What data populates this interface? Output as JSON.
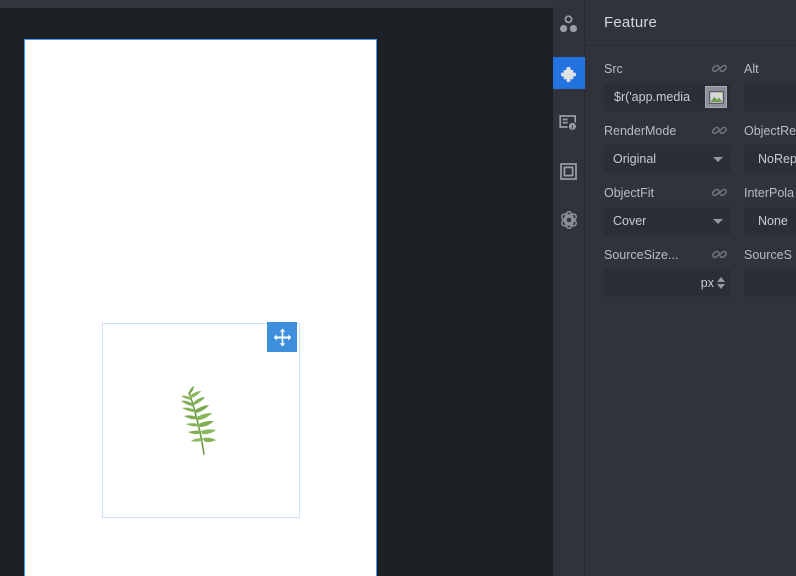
{
  "window": {
    "background_color": "#1c1f24",
    "panel_color": "#30333c",
    "accent_color": "#2272e0",
    "selection_border_color": "#3d9bf0"
  },
  "canvas": {
    "name": "device-preview-canvas",
    "background": "#ffffff",
    "selected_element": {
      "name": "image-component",
      "border_color": "#cfe2f7",
      "content": "fern-leaf-image"
    },
    "move_handle": {
      "icon": "move-arrows-icon",
      "color": "#3d8fdd"
    }
  },
  "icon_rail": {
    "items": [
      {
        "name": "structure-icon",
        "label": "Structure",
        "active": false
      },
      {
        "name": "puzzle-icon",
        "label": "Attributes",
        "active": true
      },
      {
        "name": "card-info-icon",
        "label": "Component Info",
        "active": false
      },
      {
        "name": "frame-square-icon",
        "label": "Layout",
        "active": false
      },
      {
        "name": "atom-icon",
        "label": "Effects",
        "active": false
      }
    ]
  },
  "inspector": {
    "title": "Feature",
    "rows": [
      {
        "left": {
          "label": "Src",
          "link_icon": "chain-link-icon",
          "type": "text-with-picker",
          "value": "$r('app.media",
          "placeholder": "",
          "picker_icon": "image-picker-icon"
        },
        "right": {
          "label": "Alt",
          "link_icon": "chain-link-icon",
          "type": "text",
          "value": "",
          "placeholder": ""
        }
      },
      {
        "left": {
          "label": "RenderMode",
          "link_icon": "chain-link-icon",
          "type": "select",
          "value": "Original",
          "caret_icon": "chevron-down-icon"
        },
        "right": {
          "label": "ObjectRe",
          "link_icon": "chain-link-icon",
          "type": "select",
          "value": "NoRepe",
          "caret_icon": "chevron-down-icon"
        }
      },
      {
        "left": {
          "label": "ObjectFit",
          "link_icon": "chain-link-icon",
          "type": "select",
          "value": "Cover",
          "caret_icon": "chevron-down-icon"
        },
        "right": {
          "label": "InterPola",
          "link_icon": "chain-link-icon",
          "type": "select",
          "value": "None",
          "caret_icon": "chevron-down-icon"
        }
      },
      {
        "left": {
          "label": "SourceSize...",
          "link_icon": "chain-link-icon",
          "type": "number-unit",
          "value": "",
          "unit": "px",
          "spinner_icon": "spinner-arrows-icon"
        },
        "right": {
          "label": "SourceS",
          "link_icon": "chain-link-icon",
          "type": "number-unit",
          "value": "",
          "unit": ""
        }
      }
    ]
  }
}
